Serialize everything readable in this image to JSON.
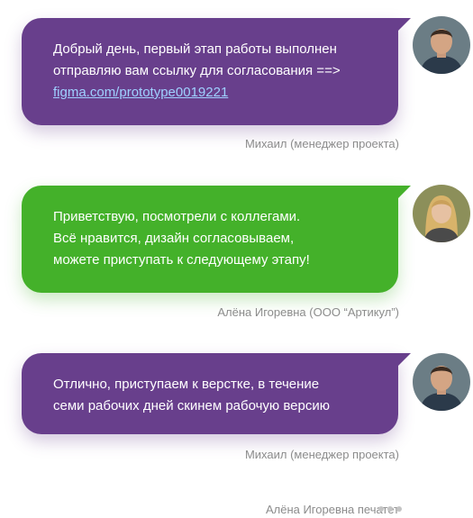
{
  "messages": [
    {
      "author": "Михаил (менеджер проекта)",
      "lines": [
        "Добрый день, первый этап работы выполнен",
        "отправляю вам ссылку для согласования ==>"
      ],
      "link": "figma.com/prototype0019221",
      "color": "#683f8c"
    },
    {
      "author": "Алёна Игоревна (ООО “Артикул”)",
      "lines": [
        "Приветствую, посмотрели с коллегами.",
        "Всё нравится, дизайн согласовываем,",
        "можете приступать к следующему этапу!"
      ],
      "color": "#44b12a"
    },
    {
      "author": "Михаил (менеджер проекта)",
      "lines": [
        "Отлично, приступаем к верстке, в течение",
        "семи рабочих дней скинем рабочую версию"
      ],
      "color": "#683f8c"
    }
  ],
  "typing_indicator": "Алёна Игоревна печатет",
  "icons": [
    "avatar-man",
    "avatar-woman",
    "avatar-man",
    "typing-dots"
  ]
}
